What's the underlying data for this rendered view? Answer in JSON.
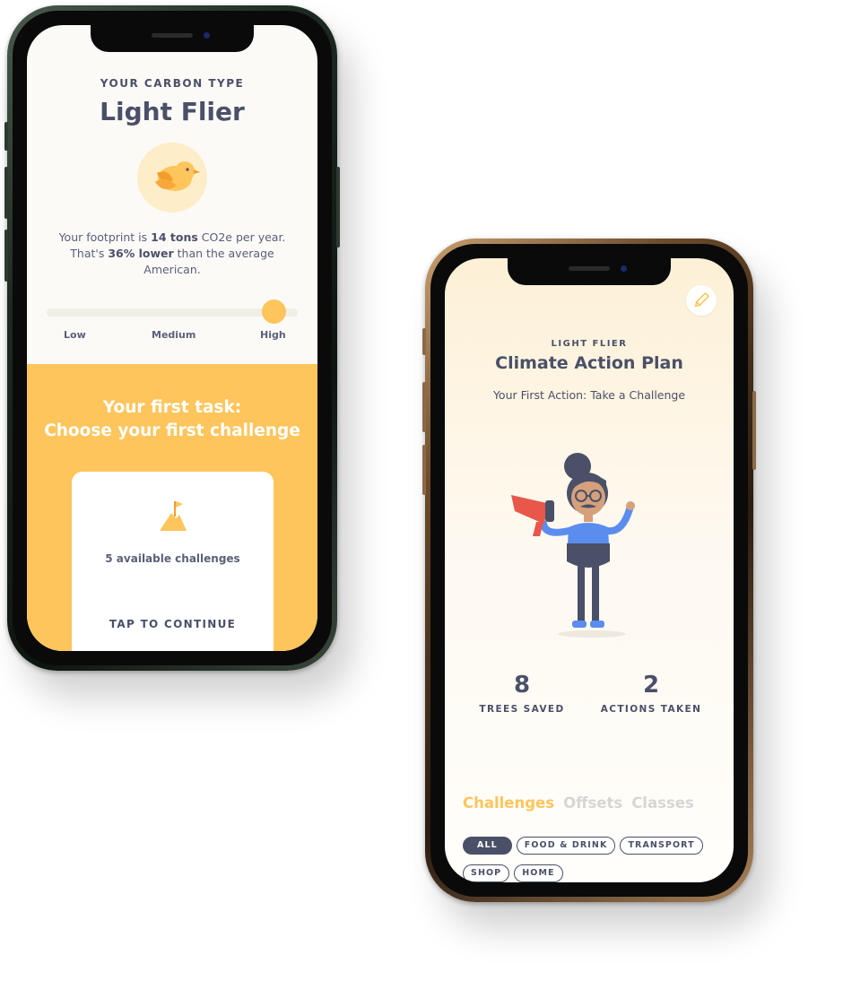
{
  "left_phone": {
    "kicker": "YOUR CARBON TYPE",
    "title": "Light Flier",
    "icon": "bird-icon",
    "desc_part1": "Your footprint is ",
    "desc_bold1": "14 tons",
    "desc_part2": " CO2e per year. That's ",
    "desc_bold2": "36% lower",
    "desc_part3": " than the average American.",
    "slider": {
      "labels": [
        "Low",
        "Medium",
        "High"
      ],
      "selected": "High"
    },
    "task_title_line1": "Your first task:",
    "task_title_line2": "Choose your first challenge",
    "card_icon": "flag-mountain-icon",
    "card_count": "5 available challenges",
    "card_cta": "TAP TO CONTINUE"
  },
  "right_phone": {
    "edit_icon": "pencil-icon",
    "kicker": "LIGHT FLIER",
    "title": "Climate Action Plan",
    "subtitle": "Your First Action: Take a Challenge",
    "illustration": "person-with-megaphone-icon",
    "stats": [
      {
        "value": "8",
        "label": "TREES SAVED"
      },
      {
        "value": "2",
        "label": "ACTIONS TAKEN"
      }
    ],
    "tabs": [
      {
        "label": "Challenges",
        "active": true
      },
      {
        "label": "Offsets",
        "active": false
      },
      {
        "label": "Classes",
        "active": false
      }
    ],
    "chips": [
      {
        "label": "ALL",
        "active": true
      },
      {
        "label": "FOOD & DRINK",
        "active": false
      },
      {
        "label": "TRANSPORT",
        "active": false
      },
      {
        "label": "SHOP",
        "active": false
      },
      {
        "label": "HOME",
        "active": false
      }
    ]
  },
  "colors": {
    "accent_yellow": "#fec55c",
    "text_navy": "#4a5068",
    "inactive_tab": "#d7d6d6"
  }
}
